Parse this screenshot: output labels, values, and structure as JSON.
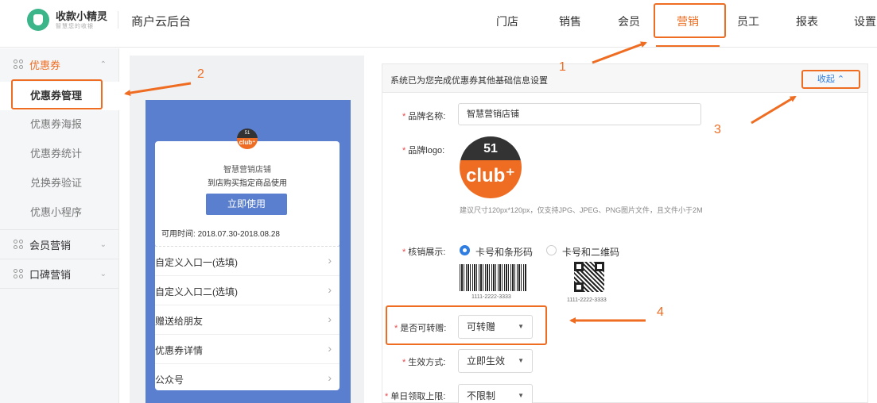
{
  "brand": {
    "name": "收款小精灵",
    "slogan": "智慧您的收银"
  },
  "app_title": "商户云后台",
  "nav": {
    "items": [
      {
        "label": "门店"
      },
      {
        "label": "销售"
      },
      {
        "label": "会员"
      },
      {
        "label": "营销",
        "active": true
      },
      {
        "label": "员工"
      },
      {
        "label": "报表"
      },
      {
        "label": "设置"
      }
    ]
  },
  "sidebar": {
    "group_coupon": "优惠券",
    "items": [
      {
        "label": "优惠券管理",
        "active": true
      },
      {
        "label": "优惠券海报"
      },
      {
        "label": "优惠券统计"
      },
      {
        "label": "兑换券验证"
      },
      {
        "label": "优惠小程序"
      }
    ],
    "group_member": "会员营销",
    "group_koubei": "口碑营销"
  },
  "preview": {
    "logo_top": "51",
    "logo_bottom": "club⁺",
    "shop_name": "智慧营销店铺",
    "desc": "到店购买指定商品使用",
    "use_button": "立即使用",
    "time_label": "可用时间:",
    "time_value": "2018.07.30-2018.08.28",
    "rows": [
      "自定义入口一(选填)",
      "自定义入口二(选填)",
      "赠送给朋友",
      "优惠券详情",
      "公众号"
    ]
  },
  "form": {
    "header_note": "系统已为您完成优惠券其他基础信息设置",
    "collapse_label": "收起 ⌃",
    "brand_name_label": "品牌名称:",
    "brand_name_value": "智慧营销店铺",
    "brand_logo_label": "品牌logo:",
    "logo_top": "51",
    "logo_bottom": "club⁺",
    "logo_hint": "建议尺寸120px*120px，仅支持JPG、JPEG、PNG图片文件，且文件小于2M",
    "verify_label": "核销展示:",
    "verify_options": [
      "卡号和条形码",
      "卡号和二维码"
    ],
    "verify_selected": "卡号和条形码",
    "barcode_number": "1111-2222-3333",
    "qrcode_number": "1111-2222-3333",
    "transfer_label": "是否可转赠:",
    "transfer_value": "可转赠",
    "effect_label": "生效方式:",
    "effect_value": "立即生效",
    "daily_limit_label": "单日领取上限:",
    "daily_limit_value": "不限制"
  },
  "annotations": [
    "1",
    "2",
    "3",
    "4"
  ],
  "colors": {
    "accent": "#ef6d22",
    "link": "#2f7de1",
    "preview_blue": "#5b7fcf",
    "brand_green": "#3cb58a"
  }
}
